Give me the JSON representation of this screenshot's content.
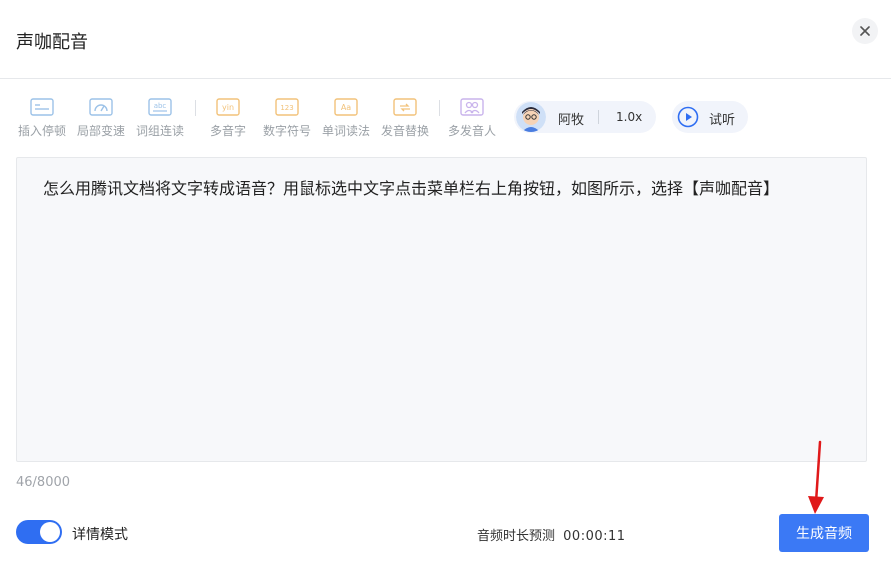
{
  "dialog": {
    "title": "声咖配音"
  },
  "toolbar": {
    "tools": [
      {
        "label": "插入停顿"
      },
      {
        "label": "局部变速"
      },
      {
        "label": "词组连读"
      },
      {
        "label": "多音字",
        "glyph": "yin"
      },
      {
        "label": "数字符号",
        "glyph": "123"
      },
      {
        "label": "单词读法",
        "glyph": "Aa"
      },
      {
        "label": "发音替换"
      },
      {
        "label": "多发音人"
      }
    ],
    "voice": {
      "name": "阿牧",
      "speed": "1.0x"
    },
    "listen_label": "试听"
  },
  "editor": {
    "text": "怎么用腾讯文档将文字转成语音？用鼠标选中文字点击菜单栏右上角按钮，如图所示，选择【声咖配音】"
  },
  "footer": {
    "char_count": "46/8000",
    "toggle_label": "详情模式",
    "toggle_on": true,
    "duration_label": "音频时长预测",
    "duration_value": "00:00:11",
    "generate_label": "生成音频"
  },
  "colors": {
    "primary": "#3b79f5",
    "toggle": "#2f6ef2",
    "icon_blue": "#9cc2e8",
    "icon_orange": "#f2c27a",
    "icon_purple": "#c9b4ec",
    "annotation_red": "#e0191a"
  }
}
